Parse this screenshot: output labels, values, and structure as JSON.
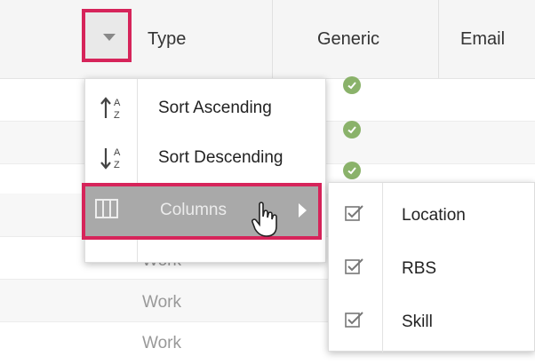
{
  "grid": {
    "columns": [
      {
        "label": "Type"
      },
      {
        "label": "Generic"
      },
      {
        "label": "Email"
      }
    ],
    "rows": [
      {
        "type": "",
        "generic_checked": true
      },
      {
        "type": "",
        "generic_checked": true
      },
      {
        "type": "",
        "generic_checked": true
      },
      {
        "type": "",
        "generic_checked": false
      },
      {
        "type": "Work",
        "generic_checked": false
      },
      {
        "type": "Work",
        "generic_checked": false
      },
      {
        "type": "Work",
        "generic_checked": false
      }
    ]
  },
  "column_menu": {
    "items": [
      {
        "label": "Sort Ascending",
        "icon": "sort-ascending-icon"
      },
      {
        "label": "Sort Descending",
        "icon": "sort-descending-icon"
      },
      {
        "label": "Columns",
        "icon": "columns-icon",
        "has_submenu": true,
        "highlighted": true
      }
    ]
  },
  "columns_submenu": {
    "items": [
      {
        "label": "Location",
        "checked": true
      },
      {
        "label": "RBS",
        "checked": true
      },
      {
        "label": "Skill",
        "checked": true
      }
    ]
  },
  "colors": {
    "highlight_border": "#d6245a",
    "check_green": "#8ab26a",
    "header_bg": "#f5f5f5"
  }
}
